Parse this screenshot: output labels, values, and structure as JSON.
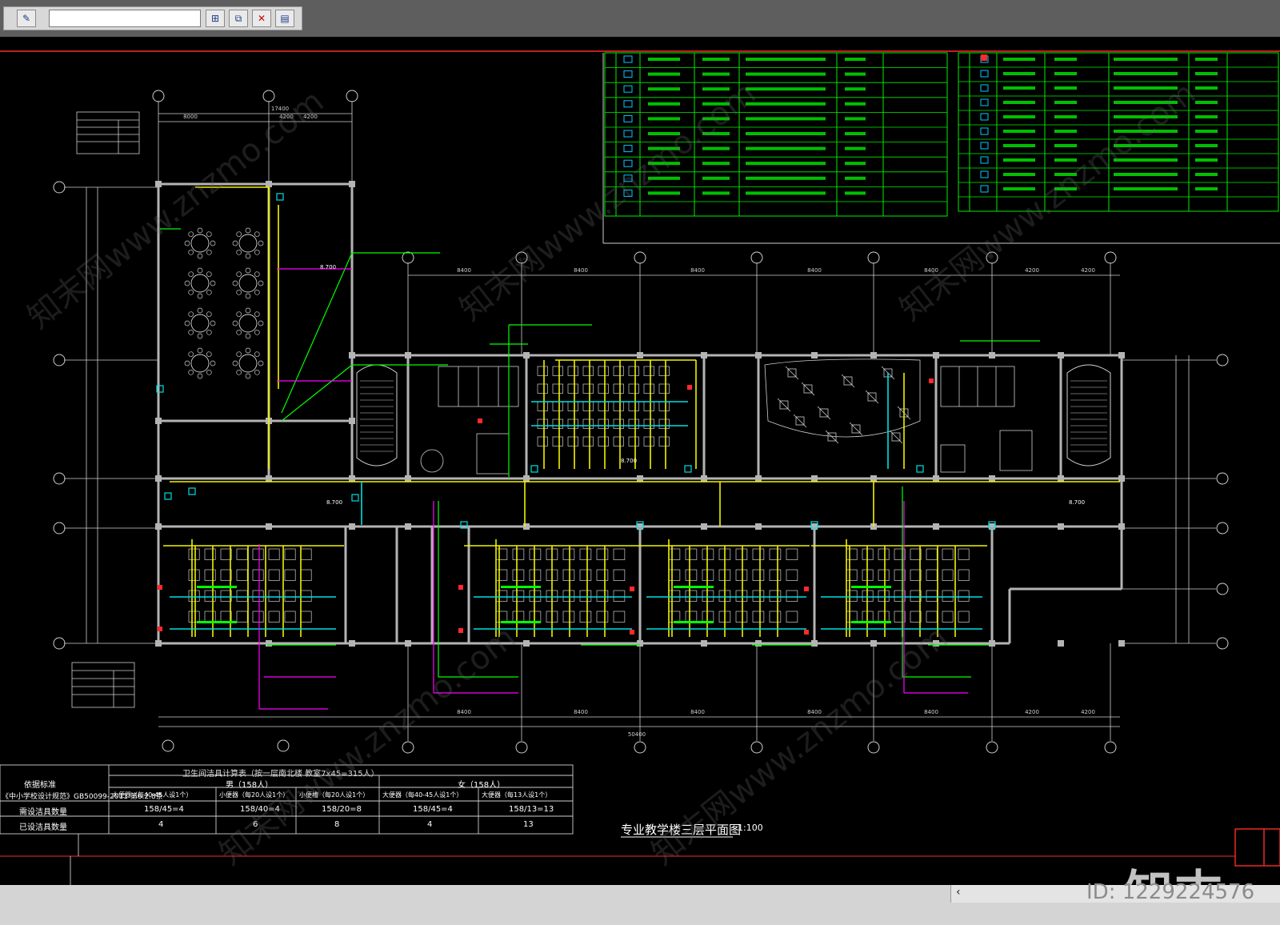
{
  "toolbar": {
    "icons": [
      "edit-icon",
      "layer-add-icon",
      "layer-copy-icon",
      "layer-delete-icon",
      "layer-properties-icon"
    ]
  },
  "drawing": {
    "title": "专业教学楼三层平面图",
    "scale": "1:100",
    "dimensions_top": [
      "8400",
      "8400",
      "8400",
      "8400",
      "8400",
      "4200",
      "4200"
    ],
    "dimensions_left_top": [
      "8000",
      "4200",
      "4200"
    ],
    "total_width": "50400",
    "total_left": "17400",
    "elevation_labels": [
      "8.700",
      "8.700",
      "8.700",
      "8.700"
    ]
  },
  "bottom_table": {
    "header": "卫生间洁具计算表（按一层南北楼 教室7x45=315人）",
    "row_label_col": "依据标准",
    "row1_label": "《中小学校设计规范》GB50099-2011 第6.2.8条",
    "col_groups": [
      "男（158人）",
      "女（158人）"
    ],
    "subheads": [
      "大便器（每40-45人设1个）",
      "小便器（每20人设1个）",
      "小便槽（每20人设1个）",
      "大便器（每40-45人设1个）",
      "大便器（每13人设1个）"
    ],
    "row2_label": "需设洁具数量",
    "row2": [
      "158/45=4",
      "158/40=4",
      "158/20=8",
      "158/45=4",
      "158/13=13"
    ],
    "row3_label": "已设洁具数量",
    "row3": [
      "4",
      "6",
      "8",
      "4",
      "13"
    ]
  },
  "branding": {
    "logo": "知末",
    "id_text": "ID: 1229224576",
    "watermark": "知末网www.znzmo.com"
  },
  "colors": {
    "canvas": "#000000",
    "wall": "#b4b4b4",
    "green": "#00ff00",
    "yellow": "#f2f200",
    "cyan": "#00e0e0",
    "magenta": "#ff00ff",
    "red": "#ff2a2a"
  }
}
